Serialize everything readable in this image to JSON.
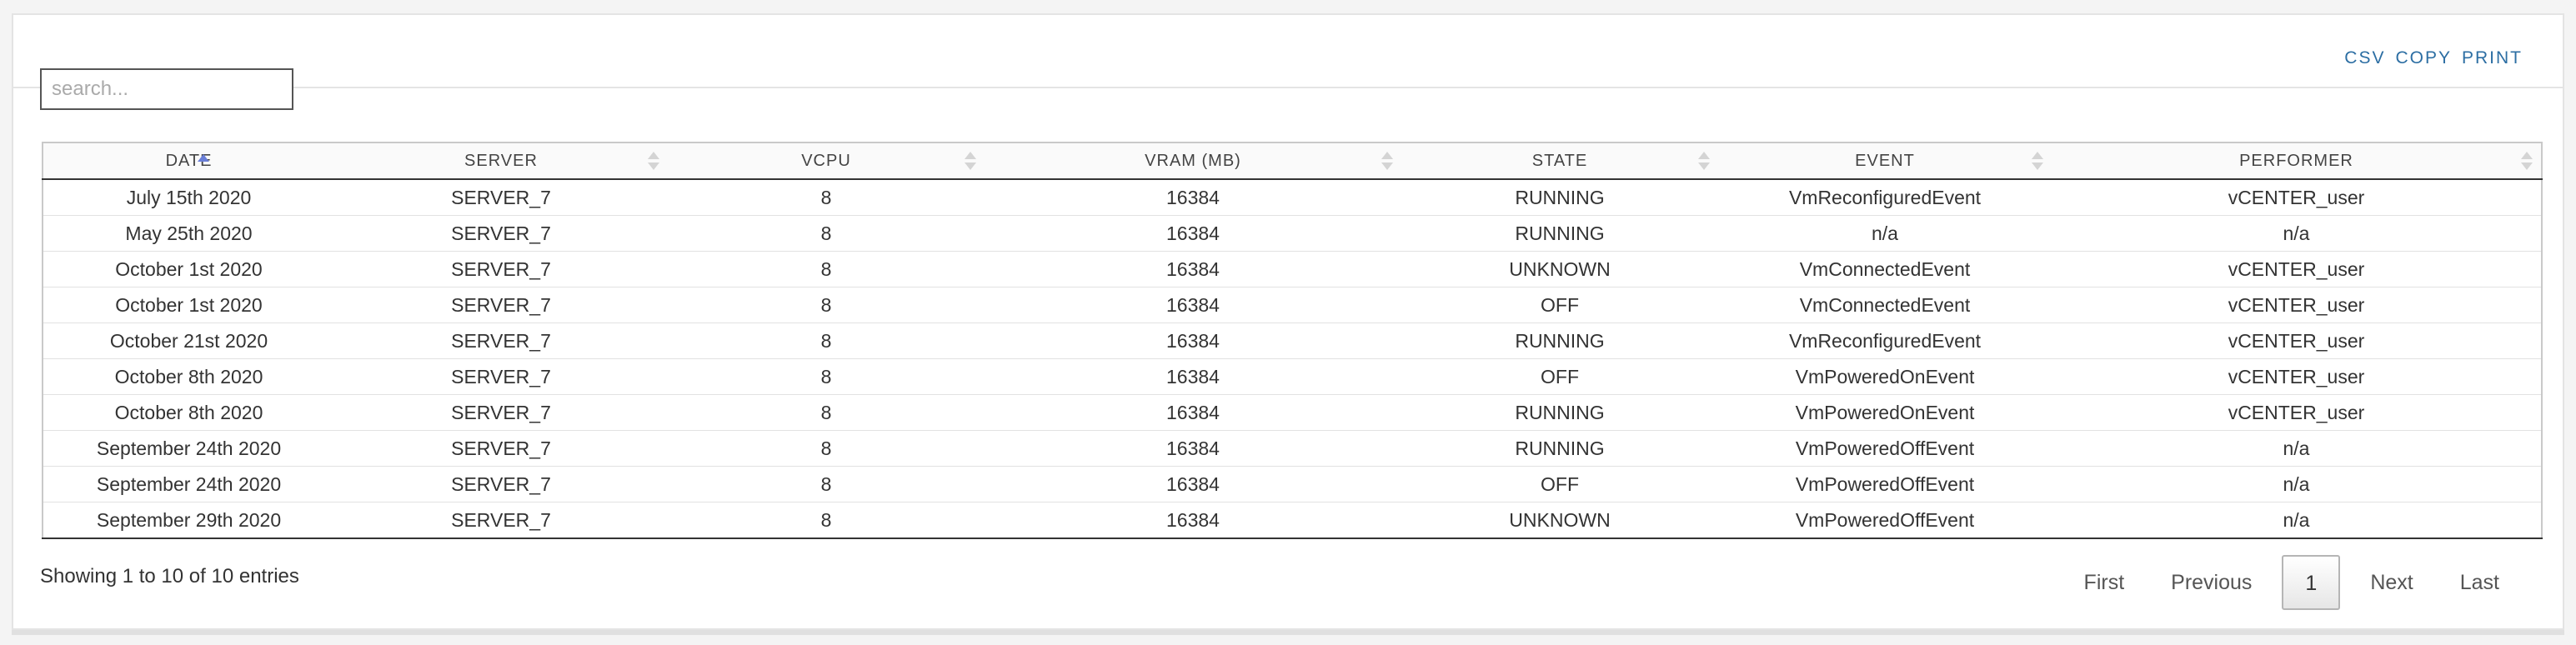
{
  "search": {
    "placeholder": "search...",
    "value": ""
  },
  "export": {
    "csv": "CSV",
    "copy": "COPY",
    "print": "PRINT"
  },
  "table": {
    "columns": [
      "DATE",
      "SERVER",
      "VCPU",
      "VRAM (MB)",
      "STATE",
      "EVENT",
      "PERFORMER"
    ],
    "sorted_column": "DATE",
    "sort_direction": "ascending",
    "rows": [
      [
        "July 15th 2020",
        "SERVER_7",
        "8",
        "16384",
        "RUNNING",
        "VmReconfiguredEvent",
        "vCENTER_user"
      ],
      [
        "May 25th 2020",
        "SERVER_7",
        "8",
        "16384",
        "RUNNING",
        "n/a",
        "n/a"
      ],
      [
        "October 1st 2020",
        "SERVER_7",
        "8",
        "16384",
        "UNKNOWN",
        "VmConnectedEvent",
        "vCENTER_user"
      ],
      [
        "October 1st 2020",
        "SERVER_7",
        "8",
        "16384",
        "OFF",
        "VmConnectedEvent",
        "vCENTER_user"
      ],
      [
        "October 21st 2020",
        "SERVER_7",
        "8",
        "16384",
        "RUNNING",
        "VmReconfiguredEvent",
        "vCENTER_user"
      ],
      [
        "October 8th 2020",
        "SERVER_7",
        "8",
        "16384",
        "OFF",
        "VmPoweredOnEvent",
        "vCENTER_user"
      ],
      [
        "October 8th 2020",
        "SERVER_7",
        "8",
        "16384",
        "RUNNING",
        "VmPoweredOnEvent",
        "vCENTER_user"
      ],
      [
        "September 24th 2020",
        "SERVER_7",
        "8",
        "16384",
        "RUNNING",
        "VmPoweredOffEvent",
        "n/a"
      ],
      [
        "September 24th 2020",
        "SERVER_7",
        "8",
        "16384",
        "OFF",
        "VmPoweredOffEvent",
        "n/a"
      ],
      [
        "September 29th 2020",
        "SERVER_7",
        "8",
        "16384",
        "UNKNOWN",
        "VmPoweredOffEvent",
        "n/a"
      ]
    ]
  },
  "info": "Showing 1 to 10 of 10 entries",
  "pagination": {
    "first": "First",
    "previous": "Previous",
    "current": "1",
    "next": "Next",
    "last": "Last"
  },
  "colors": {
    "link": "#2c6ea3",
    "sort_active": "#6a7fd8",
    "sort_inactive": "#d4d4d4"
  }
}
